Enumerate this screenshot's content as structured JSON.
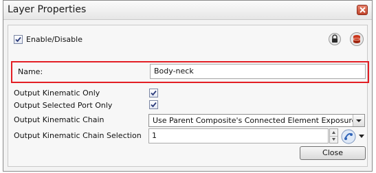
{
  "window": {
    "title": "Layer Properties"
  },
  "enable": {
    "label": "Enable/Disable",
    "checked": true
  },
  "name": {
    "label": "Name:",
    "value": "Body-neck",
    "highlight_color": "#e31e24"
  },
  "fields": {
    "output_kinematic_only": {
      "label": "Output Kinematic Only",
      "checked": true
    },
    "output_selected_port_only": {
      "label": "Output Selected Port Only",
      "checked": true
    },
    "output_kinematic_chain": {
      "label": "Output Kinematic Chain",
      "selected": "Use Parent Composite's Connected Element Exposure"
    },
    "output_kinematic_chain_selection": {
      "label": "Output Kinematic Chain Selection",
      "value": "1"
    }
  },
  "icons": {
    "lock": "lock-icon",
    "layer": "database-icon",
    "chain": "chain-select-icon",
    "menu": "chevron-down-icon",
    "window_close": "close-icon"
  },
  "buttons": {
    "close": "Close"
  }
}
